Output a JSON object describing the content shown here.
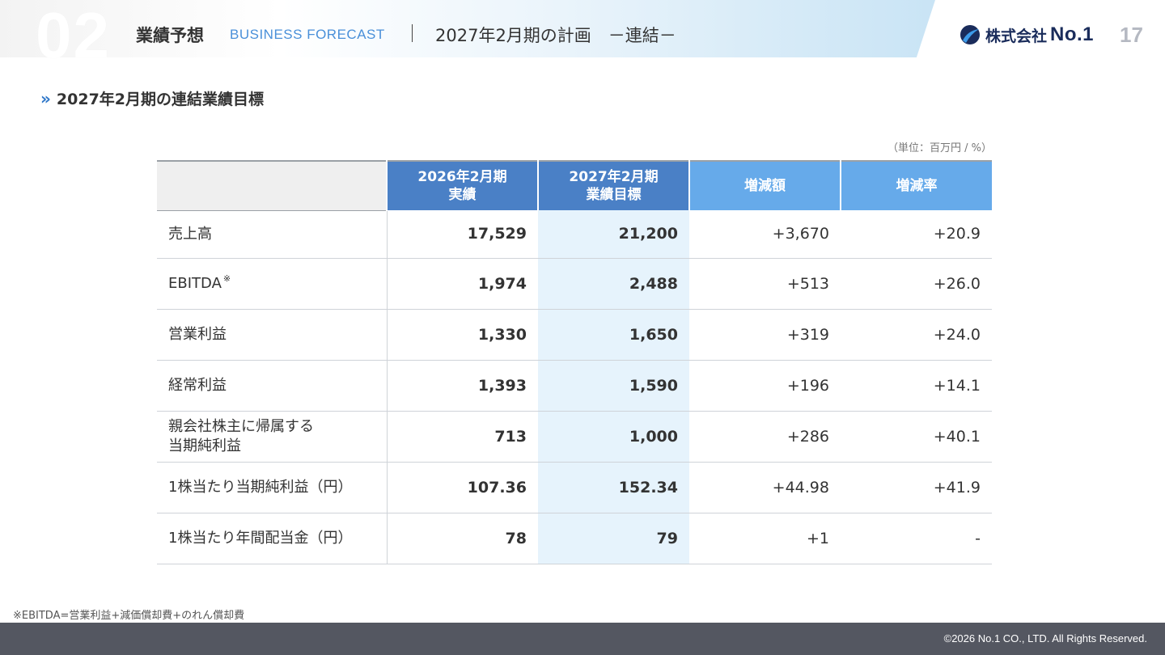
{
  "header": {
    "section_number": "02",
    "section_title": "業績予想",
    "section_subtitle": "BUSINESS FORECAST",
    "page_title": "2027年2月期の計画　－連結－",
    "logo_jp": "株式会社",
    "logo_en": "No.1",
    "page_number": "17"
  },
  "subtitle": "2027年2月期の連結業績目標",
  "unit_note": "（単位：百万円 / %）",
  "table": {
    "columns": [
      {
        "line1": "2026年2月期",
        "line2": "実績"
      },
      {
        "line1": "2027年2月期",
        "line2": "業績目標"
      },
      {
        "line1": "増減額",
        "line2": ""
      },
      {
        "line1": "増減率",
        "line2": ""
      }
    ],
    "rows": [
      {
        "label": "売上高",
        "label2": "",
        "mark": "",
        "actual": "17,529",
        "target": "21,200",
        "diff": "+3,670",
        "rate": "+20.9"
      },
      {
        "label": "EBITDA",
        "label2": "",
        "mark": "※",
        "actual": "1,974",
        "target": "2,488",
        "diff": "+513",
        "rate": "+26.0"
      },
      {
        "label": "営業利益",
        "label2": "",
        "mark": "",
        "actual": "1,330",
        "target": "1,650",
        "diff": "+319",
        "rate": "+24.0"
      },
      {
        "label": "経常利益",
        "label2": "",
        "mark": "",
        "actual": "1,393",
        "target": "1,590",
        "diff": "+196",
        "rate": "+14.1"
      },
      {
        "label": "親会社株主に帰属する",
        "label2": "当期純利益",
        "mark": "",
        "actual": "713",
        "target": "1,000",
        "diff": "+286",
        "rate": "+40.1"
      },
      {
        "label": "1株当たり当期純利益（円）",
        "label2": "",
        "mark": "",
        "actual": "107.36",
        "target": "152.34",
        "diff": "+44.98",
        "rate": "+41.9"
      },
      {
        "label": "1株当たり年間配当金（円）",
        "label2": "",
        "mark": "",
        "actual": "78",
        "target": "79",
        "diff": "+1",
        "rate": "-"
      }
    ]
  },
  "footnote": "※EBITDA=営業利益+減価償却費+のれん償却費",
  "copyright": "©2026 No.1 CO., LTD. All Rights Reserved.",
  "colors": {
    "header_dark": "#4a80c6",
    "header_light": "#66aaea",
    "target_bg": "#e6f3fc",
    "footer_bg": "#545761",
    "accent": "#2f77c9"
  }
}
